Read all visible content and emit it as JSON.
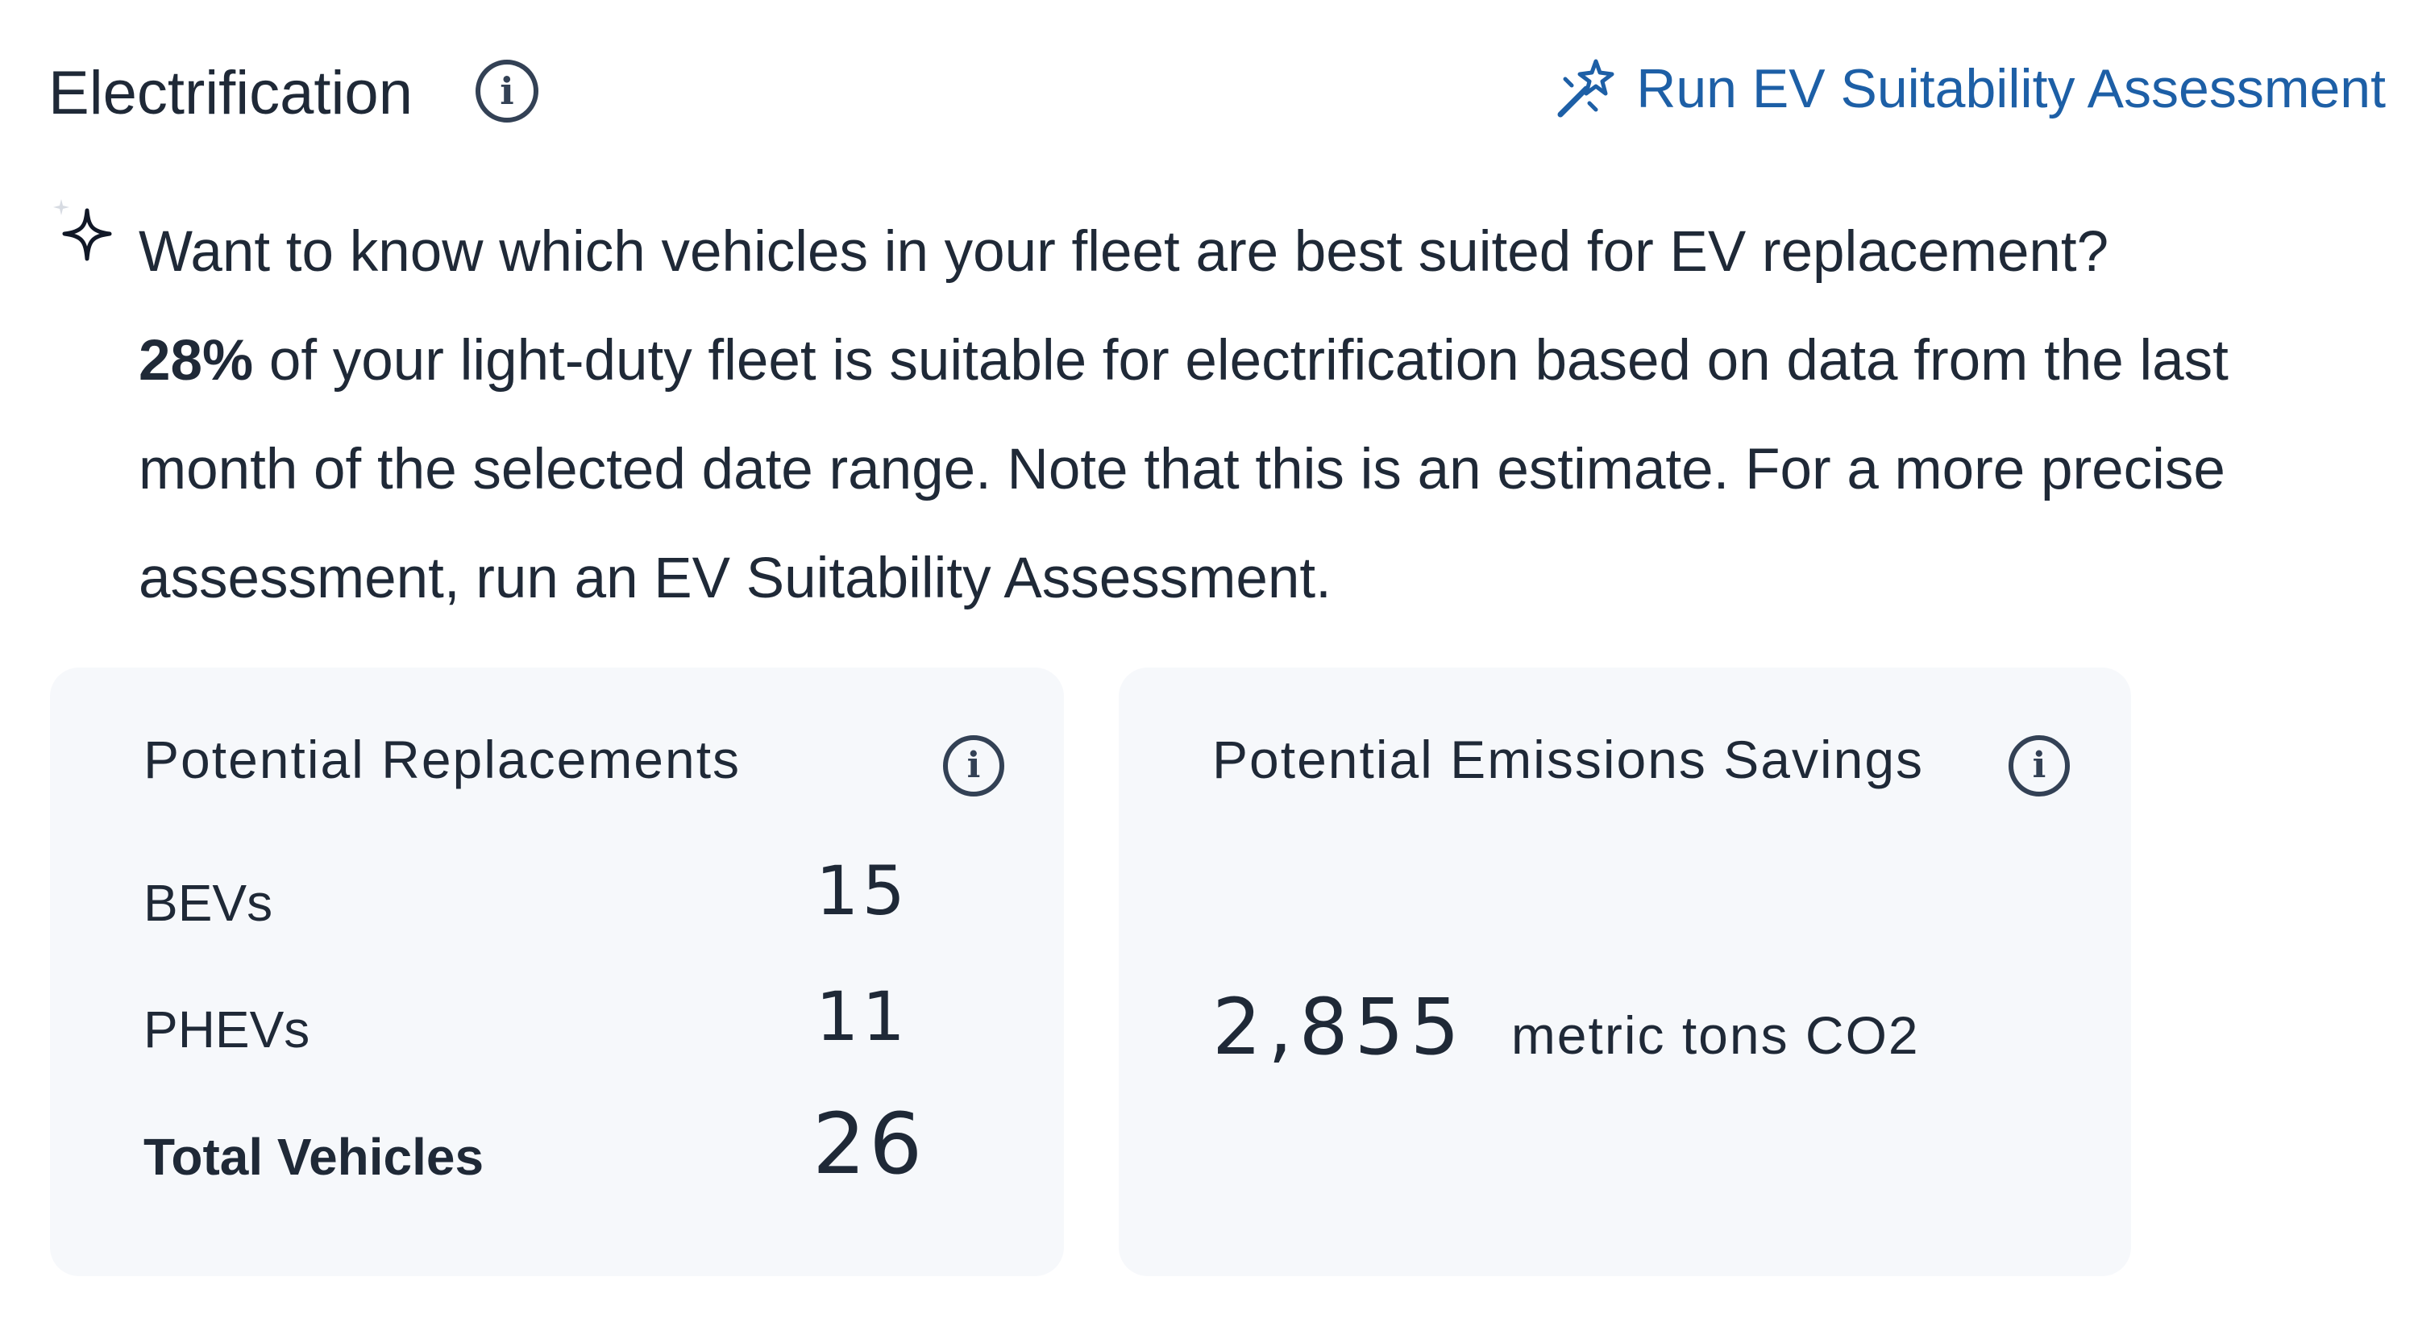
{
  "header": {
    "title": "Electrification",
    "run_assessment_label": "Run EV Suitability Assessment"
  },
  "description": {
    "question": "Want to know which vehicles in your fleet are best suited for EV replacement?",
    "percent": "28%",
    "body": " of your light-duty fleet is suitable for electrification based on data from the last month of the selected date range. Note that this is an estimate. For a more precise assessment, run an EV Suitability Assessment."
  },
  "replacements": {
    "title": "Potential Replacements",
    "rows": [
      {
        "label": "BEVs",
        "value": "15"
      },
      {
        "label": "PHEVs",
        "value": "11"
      },
      {
        "label": "Total Vehicles",
        "value": "26"
      }
    ]
  },
  "emissions": {
    "title": "Potential Emissions Savings",
    "value": "2,855",
    "unit": "metric tons CO2"
  },
  "colors": {
    "accent": "#1d5fa6",
    "text": "#1f2937",
    "card_background": "#f6f8fb",
    "icon": "#334155"
  },
  "icons": {
    "title_info": "info-icon",
    "run_assessment": "magic-wand-icon",
    "insight": "sparkle-icon"
  }
}
